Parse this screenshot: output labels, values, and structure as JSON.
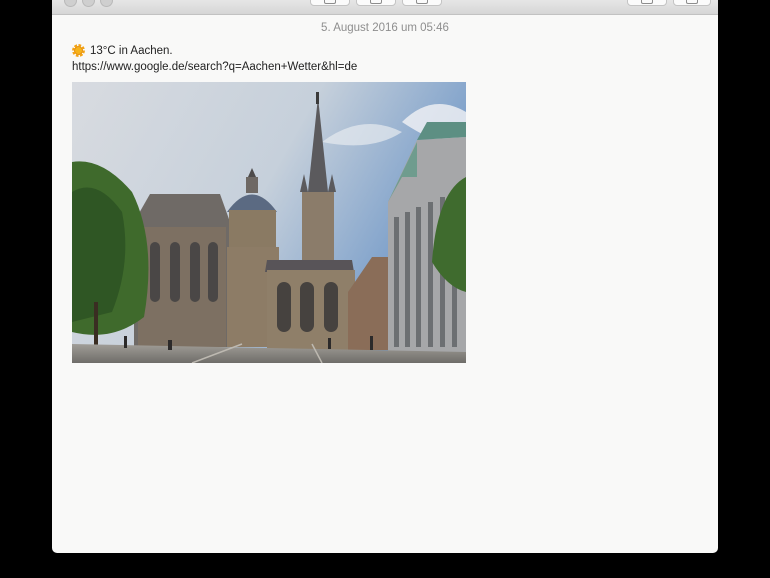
{
  "note": {
    "date": "5. August 2016 um 05:46",
    "weather_icon": "sun-icon",
    "weather_text": "13°C in Aachen.",
    "link": "https://www.google.de/search?q=Aachen+Wetter&hl=de"
  },
  "toolbar": {
    "icons": [
      "trash-icon",
      "lock-icon",
      "media-icon",
      "share-icon",
      "compose-icon"
    ]
  },
  "image": {
    "subject": "Aachen Cathedral photo"
  }
}
